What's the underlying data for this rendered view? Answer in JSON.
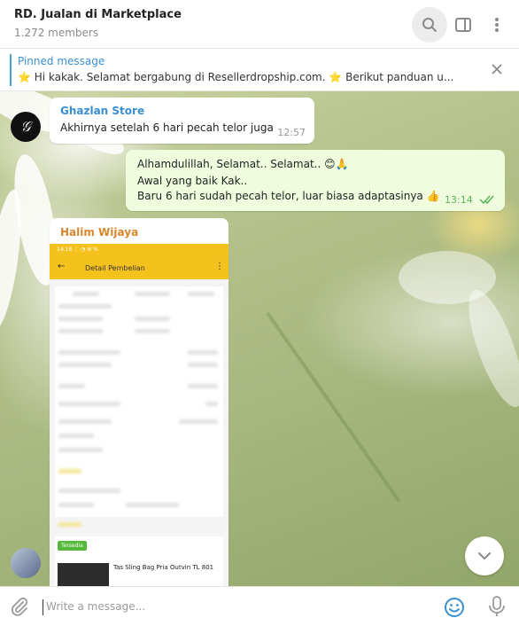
{
  "header": {
    "title": "RD. Jualan di Marketplace",
    "subtitle": "1.272 members"
  },
  "pinned": {
    "title": "Pinned message",
    "text": "⭐ Hi kakak. Selamat bergabung di Resellerdropship.com. ⭐  Berikut panduan u..."
  },
  "messages": [
    {
      "sender": "Ghazlan Store",
      "text": "Akhirnya setelah 6 hari pecah telor juga",
      "time": "12:57"
    },
    {
      "lines": [
        "Alhamdulillah, Selamat.. Selamat.. 😊🙏",
        "Awal yang baik Kak..",
        "Baru 6 hari sudah pecah telor, luar biasa adaptasinya 👍"
      ],
      "time": "13:14"
    },
    {
      "sender": "Halim Wijaya",
      "screenshot": {
        "status": "14.18 ⋮ ◔ ✉ %",
        "title": "Detail Pembelian",
        "tag": "Tersedia",
        "product": "Tas Sling Bag Pria Outvin TL 801"
      }
    }
  ],
  "composer": {
    "placeholder": "Write a message..."
  },
  "colors": {
    "accent": "#3a8fd0",
    "outgoing_bubble": "#effdde",
    "sender_orange": "#d8862a",
    "header_yellow": "#f4c21d",
    "read_ticks": "#5bb25b"
  }
}
